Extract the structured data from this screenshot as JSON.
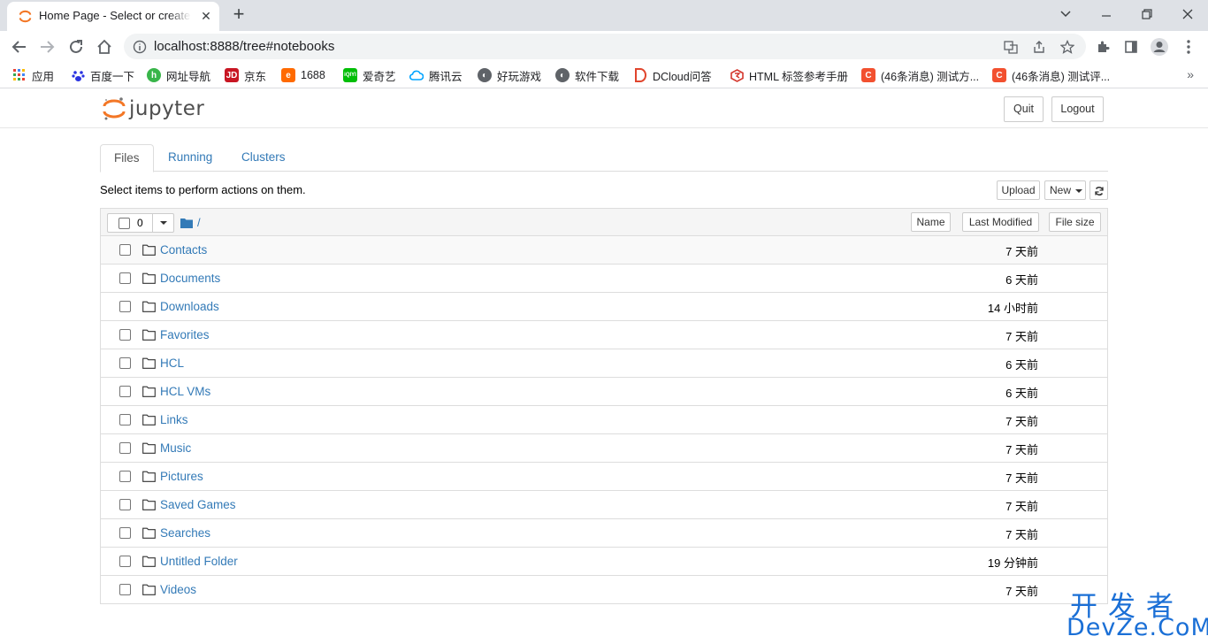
{
  "browser": {
    "tab_title": "Home Page - Select or create a notebook",
    "url": "localhost:8888/tree#notebooks",
    "bookmarks": [
      {
        "label": "应用",
        "icon": "apps-grid-icon",
        "color": "#4285f4"
      },
      {
        "label": "百度一下",
        "icon": "baidu-paw-icon",
        "color": "#2932e1"
      },
      {
        "label": "网址导航",
        "icon": "hao123-icon",
        "color": "#39b54a"
      },
      {
        "label": "京东",
        "icon": "jd-icon",
        "color": "#c81623"
      },
      {
        "label": "1688",
        "icon": "1688-icon",
        "color": "#ff6a00"
      },
      {
        "label": "爱奇艺",
        "icon": "iqiyi-icon",
        "color": "#00be06"
      },
      {
        "label": "腾讯云",
        "icon": "tencent-cloud-icon",
        "color": "#00a3ff"
      },
      {
        "label": "好玩游戏",
        "icon": "globe-icon",
        "color": "#5f6368"
      },
      {
        "label": "软件下载",
        "icon": "globe-icon",
        "color": "#5f6368"
      },
      {
        "label": "DCloud问答",
        "icon": "dcloud-icon",
        "color": "#e0452d"
      },
      {
        "label": "HTML 标签参考手册",
        "icon": "w3school-icon",
        "color": "#d4372d"
      },
      {
        "label": "(46条消息) 测试方...",
        "icon": "csdn-icon",
        "color": "#f2502f"
      },
      {
        "label": "(46条消息) 测试评...",
        "icon": "csdn-icon",
        "color": "#f2502f"
      }
    ]
  },
  "jupyter": {
    "logo_text": "jupyter",
    "quit_label": "Quit",
    "logout_label": "Logout",
    "tabs": [
      {
        "label": "Files"
      },
      {
        "label": "Running"
      },
      {
        "label": "Clusters"
      }
    ],
    "hint": "Select items to perform actions on them.",
    "upload_label": "Upload",
    "new_label": "New",
    "selected_count": "0",
    "breadcrumb": "/",
    "sort": {
      "name_label": "Name",
      "modified_label": "Last Modified",
      "size_label": "File size"
    },
    "files": [
      {
        "name": "Contacts",
        "modified": "7 天前"
      },
      {
        "name": "Documents",
        "modified": "6 天前"
      },
      {
        "name": "Downloads",
        "modified": "14 小时前"
      },
      {
        "name": "Favorites",
        "modified": "7 天前"
      },
      {
        "name": "HCL",
        "modified": "6 天前"
      },
      {
        "name": "HCL VMs",
        "modified": "6 天前"
      },
      {
        "name": "Links",
        "modified": "7 天前"
      },
      {
        "name": "Music",
        "modified": "7 天前"
      },
      {
        "name": "Pictures",
        "modified": "7 天前"
      },
      {
        "name": "Saved Games",
        "modified": "7 天前"
      },
      {
        "name": "Searches",
        "modified": "7 天前"
      },
      {
        "name": "Untitled Folder",
        "modified": "19 分钟前"
      },
      {
        "name": "Videos",
        "modified": "7 天前"
      }
    ]
  },
  "watermark": {
    "cn": "开发者",
    "en": "DevZe.CoM"
  },
  "colors": {
    "link": "#337ab7",
    "jupyter_orange": "#f37726"
  }
}
